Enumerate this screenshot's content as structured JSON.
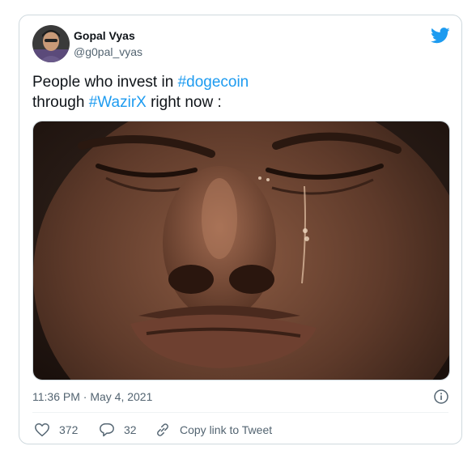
{
  "tweet": {
    "author_name": "Gopal Vyas",
    "author_handle": "@g0pal_vyas",
    "text_line1_prefix": "People who invest in ",
    "hashtag1": "#dogecoin",
    "text_line2_prefix": "through ",
    "hashtag2": "#WazirX",
    "text_line2_suffix": " right now :",
    "timestamp": "11:36 PM · May 4, 2021",
    "like_count": "372",
    "reply_count": "32",
    "copy_link_label": "Copy link to Tweet"
  },
  "icons": {
    "brand": "twitter-bird-icon",
    "info": "info-icon",
    "like": "heart-icon",
    "reply": "speech-bubble-icon",
    "copy": "link-icon"
  },
  "colors": {
    "accent": "#1d9bf0",
    "text": "#0f1419",
    "muted": "#536471",
    "border": "#cfd9de"
  }
}
